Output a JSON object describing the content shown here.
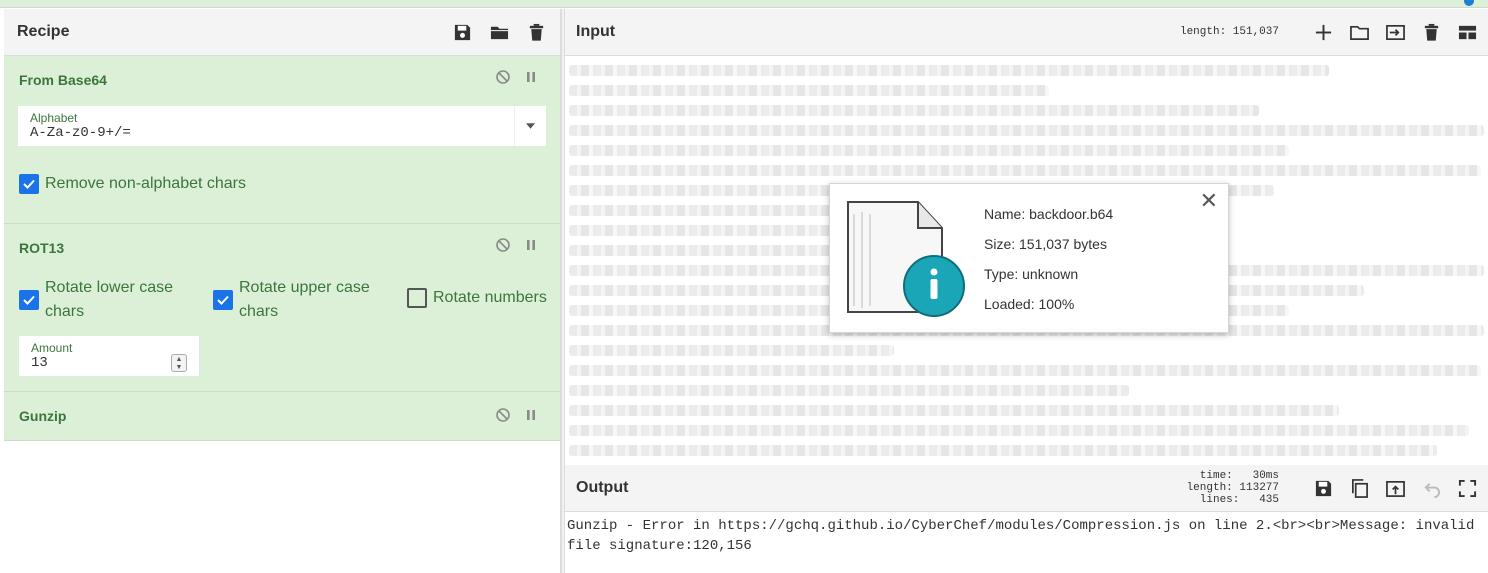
{
  "recipe": {
    "title": "Recipe",
    "operations": [
      {
        "name": "From Base64",
        "alphabet_label": "Alphabet",
        "alphabet_value": "A-Za-z0-9+/=",
        "remove_label": "Remove non-alphabet chars",
        "remove_checked": true
      },
      {
        "name": "ROT13",
        "lower_label_1": "Rotate lower case",
        "lower_label_2": "chars",
        "upper_label_1": "Rotate upper case",
        "upper_label_2": "chars",
        "numbers_label": "Rotate numbers",
        "amount_label": "Amount",
        "amount_value": "13"
      },
      {
        "name": "Gunzip"
      }
    ]
  },
  "input": {
    "title": "Input",
    "length_label": "length: 151,037"
  },
  "output": {
    "title": "Output",
    "time": "time:   30ms",
    "length": "length: 113277",
    "lines": "lines:   435",
    "text": "Gunzip - Error in https://gchq.github.io/CyberChef/modules/Compression.js on line 2.<br><br>Message: invalid file signature:120,156"
  },
  "file": {
    "name": "Name: backdoor.b64",
    "size": "Size: 151,037 bytes",
    "type": "Type: unknown",
    "loaded": "Loaded: 100%",
    "close_glyph": "✕"
  },
  "colors": {
    "op_bg": "#dcf0d8",
    "op_text": "#3c763d",
    "checkbox_on": "#1a73e8",
    "info_teal": "#1aa6b7"
  }
}
